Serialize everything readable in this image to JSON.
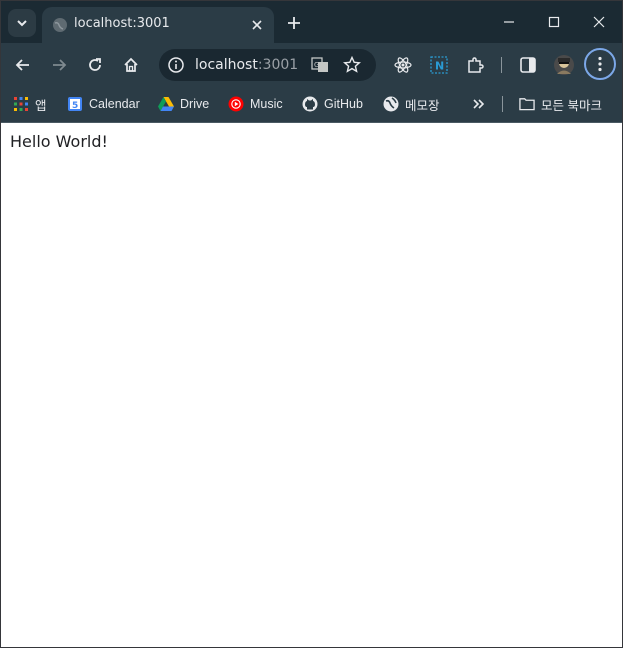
{
  "tab": {
    "title": "localhost:3001"
  },
  "omnibox": {
    "host": "localhost",
    "port": ":3001"
  },
  "bookmarks": {
    "apps_label": "앱",
    "items": [
      {
        "label": "Calendar",
        "icon": "calendar-icon"
      },
      {
        "label": "Drive",
        "icon": "drive-icon"
      },
      {
        "label": "Music",
        "icon": "music-icon"
      },
      {
        "label": "GitHub",
        "icon": "github-icon"
      },
      {
        "label": "메모장",
        "icon": "globe-icon"
      }
    ],
    "all_bookmarks_label": "모든 북마크"
  },
  "page": {
    "text": "Hello World!"
  },
  "colors": {
    "titlebar": "#1b2a33",
    "toolbar": "#2b3c46",
    "omnibox": "#1a2831",
    "text_light": "#e8eaed"
  }
}
